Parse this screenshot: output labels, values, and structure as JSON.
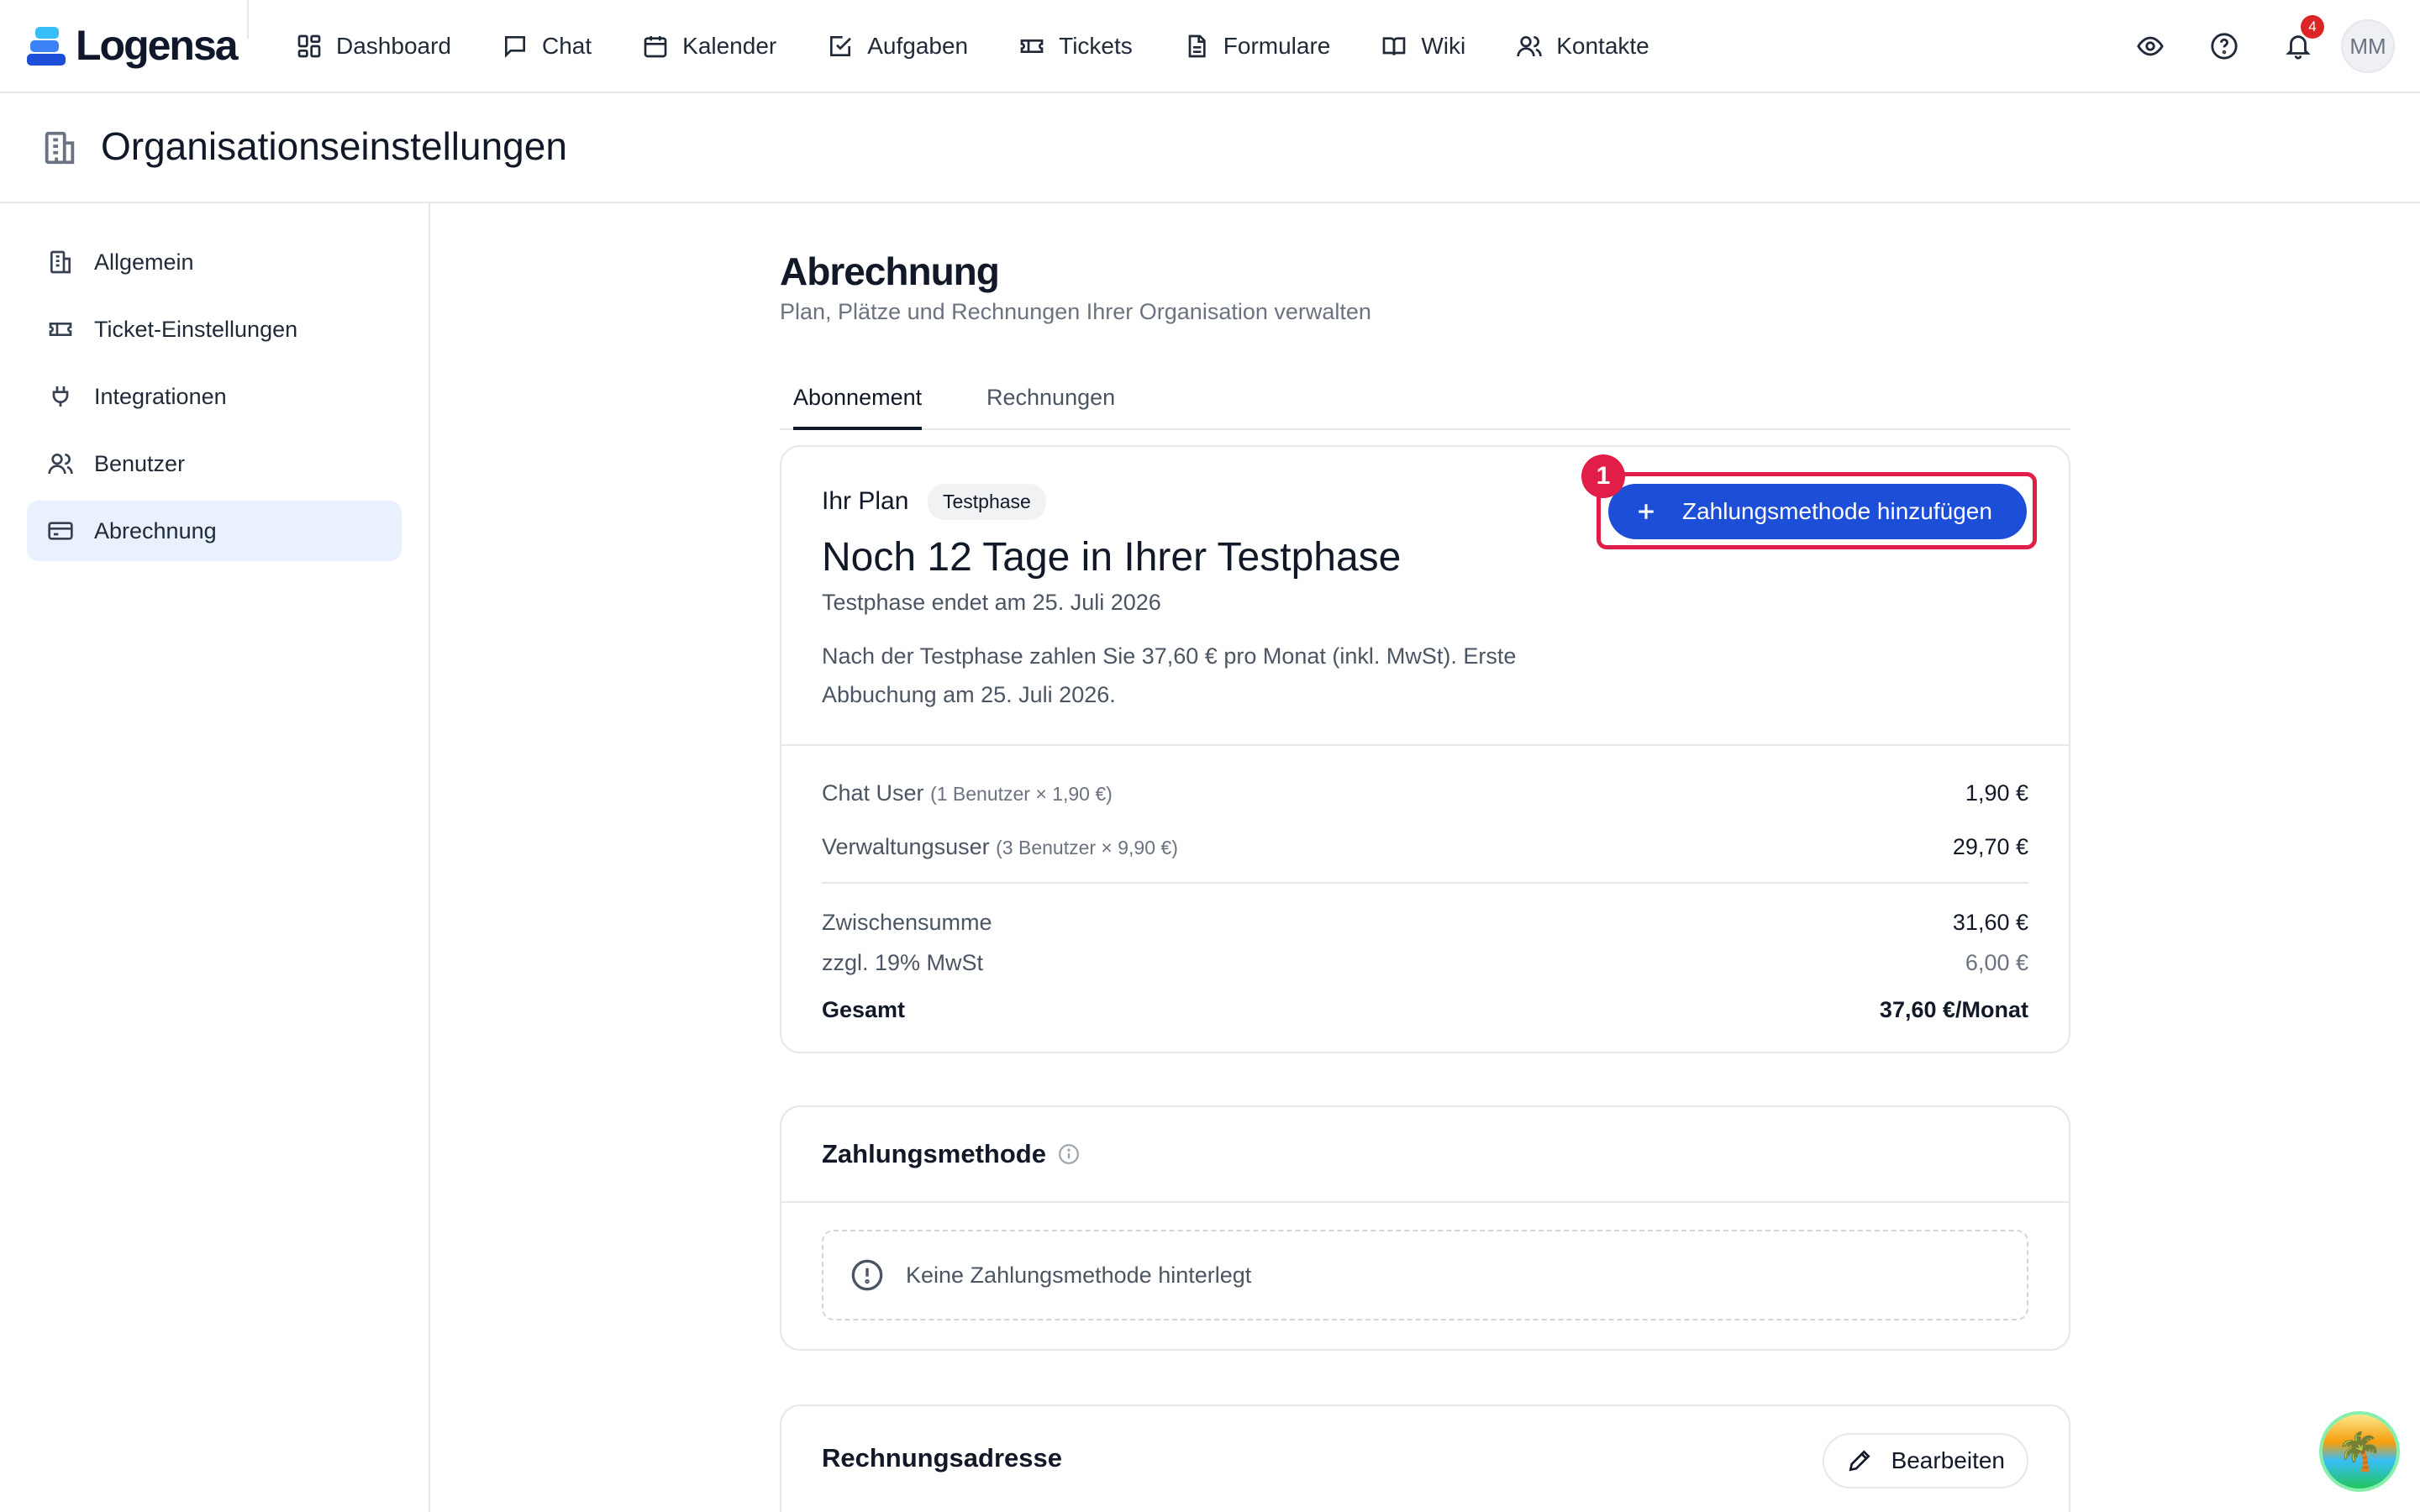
{
  "app": {
    "name": "Logensa"
  },
  "nav": {
    "items": [
      {
        "label": "Dashboard",
        "icon": "dashboard-icon"
      },
      {
        "label": "Chat",
        "icon": "chat-icon"
      },
      {
        "label": "Kalender",
        "icon": "calendar-icon"
      },
      {
        "label": "Aufgaben",
        "icon": "task-icon"
      },
      {
        "label": "Tickets",
        "icon": "ticket-icon"
      },
      {
        "label": "Formulare",
        "icon": "form-icon"
      },
      {
        "label": "Wiki",
        "icon": "book-icon"
      },
      {
        "label": "Kontakte",
        "icon": "contacts-icon"
      }
    ]
  },
  "top_actions": {
    "notification_count": "4",
    "avatar_initials": "MM"
  },
  "page": {
    "title": "Organisationseinstellungen"
  },
  "sidebar": {
    "items": [
      {
        "label": "Allgemein",
        "icon": "building-icon",
        "active": false
      },
      {
        "label": "Ticket-Einstellungen",
        "icon": "ticket-icon",
        "active": false
      },
      {
        "label": "Integrationen",
        "icon": "plug-icon",
        "active": false
      },
      {
        "label": "Benutzer",
        "icon": "users-icon",
        "active": false
      },
      {
        "label": "Abrechnung",
        "icon": "credit-card-icon",
        "active": true
      }
    ]
  },
  "billing": {
    "title": "Abrechnung",
    "subtitle": "Plan, Plätze und Rechnungen Ihrer Organisation verwalten",
    "tabs": [
      {
        "label": "Abonnement",
        "active": true
      },
      {
        "label": "Rechnungen",
        "active": false
      }
    ]
  },
  "plan": {
    "label": "Ihr Plan",
    "badge": "Testphase",
    "headline": "Noch 12 Tage in Ihrer Testphase",
    "ends": "Testphase endet am 25. Juli 2026",
    "note": "Nach der Testphase zahlen Sie 37,60 € pro Monat (inkl. MwSt). Erste Abbuchung am 25. Juli 2026.",
    "add_payment_label": "Zahlungsmethode hinzufügen",
    "marker": "1",
    "lines": [
      {
        "label": "Chat User",
        "meta": "(1 Benutzer × 1,90 €)",
        "amount": "1,90 €"
      },
      {
        "label": "Verwaltungsuser",
        "meta": "(3 Benutzer × 9,90 €)",
        "amount": "29,70 €"
      }
    ],
    "subtotal": {
      "label": "Zwischensumme",
      "amount": "31,60 €"
    },
    "vat": {
      "label": "zzgl. 19% MwSt",
      "amount": "6,00 €"
    },
    "total": {
      "label": "Gesamt",
      "amount": "37,60 €/Monat"
    }
  },
  "payment": {
    "title": "Zahlungsmethode",
    "empty": "Keine Zahlungsmethode hinterlegt"
  },
  "address": {
    "title": "Rechnungsadresse",
    "edit_label": "Bearbeiten"
  },
  "colors": {
    "accent": "#1d4ed8",
    "highlight": "#e11d48",
    "active_bg": "#e8f1fd",
    "badge": "#dc2626"
  }
}
